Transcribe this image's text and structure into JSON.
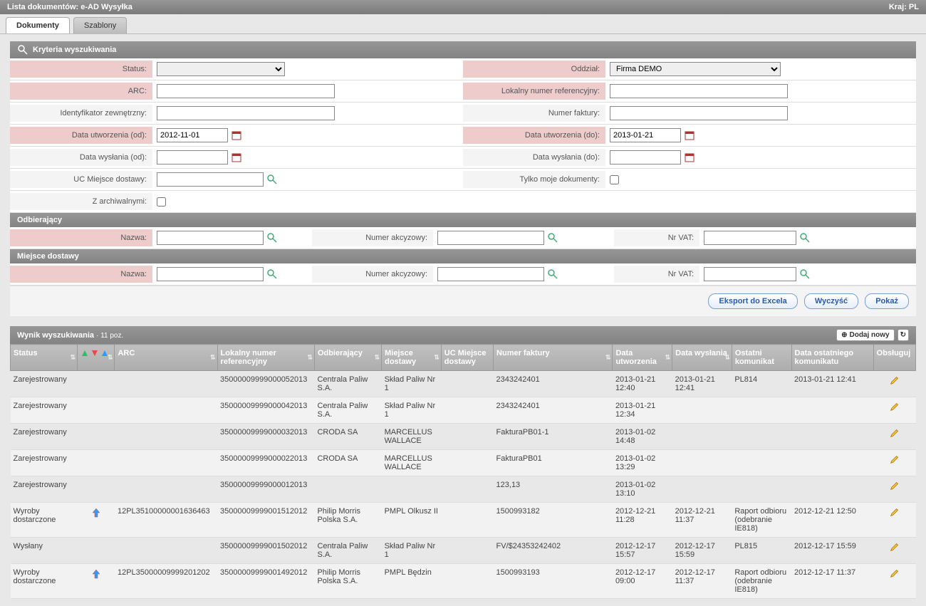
{
  "titlebar": {
    "title": "Lista dokumentów:  e-AD Wysyłka",
    "country_label": "Kraj: PL"
  },
  "tabs": {
    "documents": "Dokumenty",
    "templates": "Szablony"
  },
  "search": {
    "header": "Kryteria wyszukiwania",
    "labels": {
      "status": "Status:",
      "arc": "ARC:",
      "ext_id": "Identyfikator zewnętrzny:",
      "created_from": "Data utworzenia (od):",
      "sent_from": "Data wysłania (od):",
      "uc_delivery": "UC Miejsce dostawy:",
      "archived": "Z archiwalnymi:",
      "branch": "Oddział:",
      "local_ref": "Lokalny numer referencyjny:",
      "invoice": "Numer faktury:",
      "created_to": "Data utworzenia (do):",
      "sent_to": "Data wysłania (do):",
      "my_docs": "Tylko moje dokumenty:"
    },
    "values": {
      "status": "",
      "arc": "",
      "ext_id": "",
      "created_from": "2012-11-01",
      "sent_from": "",
      "uc_delivery": "",
      "branch": "Firma DEMO",
      "local_ref": "",
      "invoice": "",
      "created_to": "2013-01-21",
      "sent_to": ""
    }
  },
  "receiver": {
    "header": "Odbierający",
    "labels": {
      "name": "Nazwa:",
      "excise": "Numer akcyzowy:",
      "vat": "Nr VAT:"
    },
    "values": {
      "name": "",
      "excise": "",
      "vat": ""
    }
  },
  "delivery": {
    "header": "Miejsce dostawy",
    "labels": {
      "name": "Nazwa:",
      "excise": "Numer akcyzowy:",
      "vat": "Nr VAT:"
    },
    "values": {
      "name": "",
      "excise": "",
      "vat": ""
    }
  },
  "buttons": {
    "export": "Eksport do Excela",
    "clear": "Wyczyść",
    "show": "Pokaż"
  },
  "results": {
    "header": "Wynik wyszukiwania",
    "count": "11 poz.",
    "add_new": "Dodaj nowy",
    "columns": {
      "status": "Status",
      "arc": "ARC",
      "local_ref": "Lokalny numer referencyjny",
      "receiver": "Odbierający",
      "delivery_place": "Miejsce dostawy",
      "uc_delivery": "UC Miejsce dostawy",
      "invoice": "Numer faktury",
      "created": "Data utworzenia",
      "sent": "Data wysłania",
      "last_msg": "Ostatni komunikat",
      "last_msg_date": "Data ostatniego komunikatu",
      "manage": "Obsługuj"
    },
    "rows": [
      {
        "status": "Zarejestrowany",
        "arrow": "",
        "arc": "",
        "local_ref": "35000009999000052013",
        "receiver": "Centrala Paliw S.A.",
        "delivery": "Skład Paliw Nr 1",
        "uc": "",
        "invoice": "2343242401",
        "created": "2013-01-21 12:40",
        "sent": "2013-01-21 12:41",
        "last_msg": "PL814",
        "last_msg_date": "2013-01-21 12:41"
      },
      {
        "status": "Zarejestrowany",
        "arrow": "",
        "arc": "",
        "local_ref": "35000009999000042013",
        "receiver": "Centrala Paliw S.A.",
        "delivery": "Skład Paliw Nr 1",
        "uc": "",
        "invoice": "2343242401",
        "created": "2013-01-21 12:34",
        "sent": "",
        "last_msg": "",
        "last_msg_date": ""
      },
      {
        "status": "Zarejestrowany",
        "arrow": "",
        "arc": "",
        "local_ref": "35000009999000032013",
        "receiver": "CRODA SA",
        "delivery": "MARCELLUS WALLACE",
        "uc": "",
        "invoice": "FakturaPB01-1",
        "created": "2013-01-02 14:48",
        "sent": "",
        "last_msg": "",
        "last_msg_date": ""
      },
      {
        "status": "Zarejestrowany",
        "arrow": "",
        "arc": "",
        "local_ref": "35000009999000022013",
        "receiver": "CRODA SA",
        "delivery": "MARCELLUS WALLACE",
        "uc": "",
        "invoice": "FakturaPB01",
        "created": "2013-01-02 13:29",
        "sent": "",
        "last_msg": "",
        "last_msg_date": ""
      },
      {
        "status": "Zarejestrowany",
        "arrow": "",
        "arc": "",
        "local_ref": "35000009999000012013",
        "receiver": "",
        "delivery": "",
        "uc": "",
        "invoice": "123,13",
        "created": "2013-01-02 13:10",
        "sent": "",
        "last_msg": "",
        "last_msg_date": ""
      },
      {
        "status": "Wyroby dostarczone",
        "arrow": "up",
        "arc": "12PL35100000001636463",
        "local_ref": "35000009999001512012",
        "receiver": "Philip Morris Polska S.A.",
        "delivery": "PMPL Olkusz II",
        "uc": "",
        "invoice": "1500993182",
        "created": "2012-12-21 11:28",
        "sent": "2012-12-21 11:37",
        "last_msg": "Raport odbioru (odebranie IE818)",
        "last_msg_date": "2012-12-21 12:50"
      },
      {
        "status": "Wysłany",
        "arrow": "",
        "arc": "",
        "local_ref": "35000009999001502012",
        "receiver": "Centrala Paliw S.A.",
        "delivery": "Skład Paliw Nr 1",
        "uc": "",
        "invoice": "FV/$24353242402",
        "created": "2012-12-17 15:57",
        "sent": "2012-12-17 15:59",
        "last_msg": "PL815",
        "last_msg_date": "2012-12-17 15:59"
      },
      {
        "status": "Wyroby dostarczone",
        "arrow": "up",
        "arc": "12PL35000009999201202",
        "local_ref": "35000009999001492012",
        "receiver": "Philip Morris Polska S.A.",
        "delivery": "PMPL Będzin",
        "uc": "",
        "invoice": "1500993193",
        "created": "2012-12-17 09:00",
        "sent": "2012-12-17 11:37",
        "last_msg": "Raport odbioru (odebranie IE818)",
        "last_msg_date": "2012-12-17 11:37"
      }
    ]
  }
}
